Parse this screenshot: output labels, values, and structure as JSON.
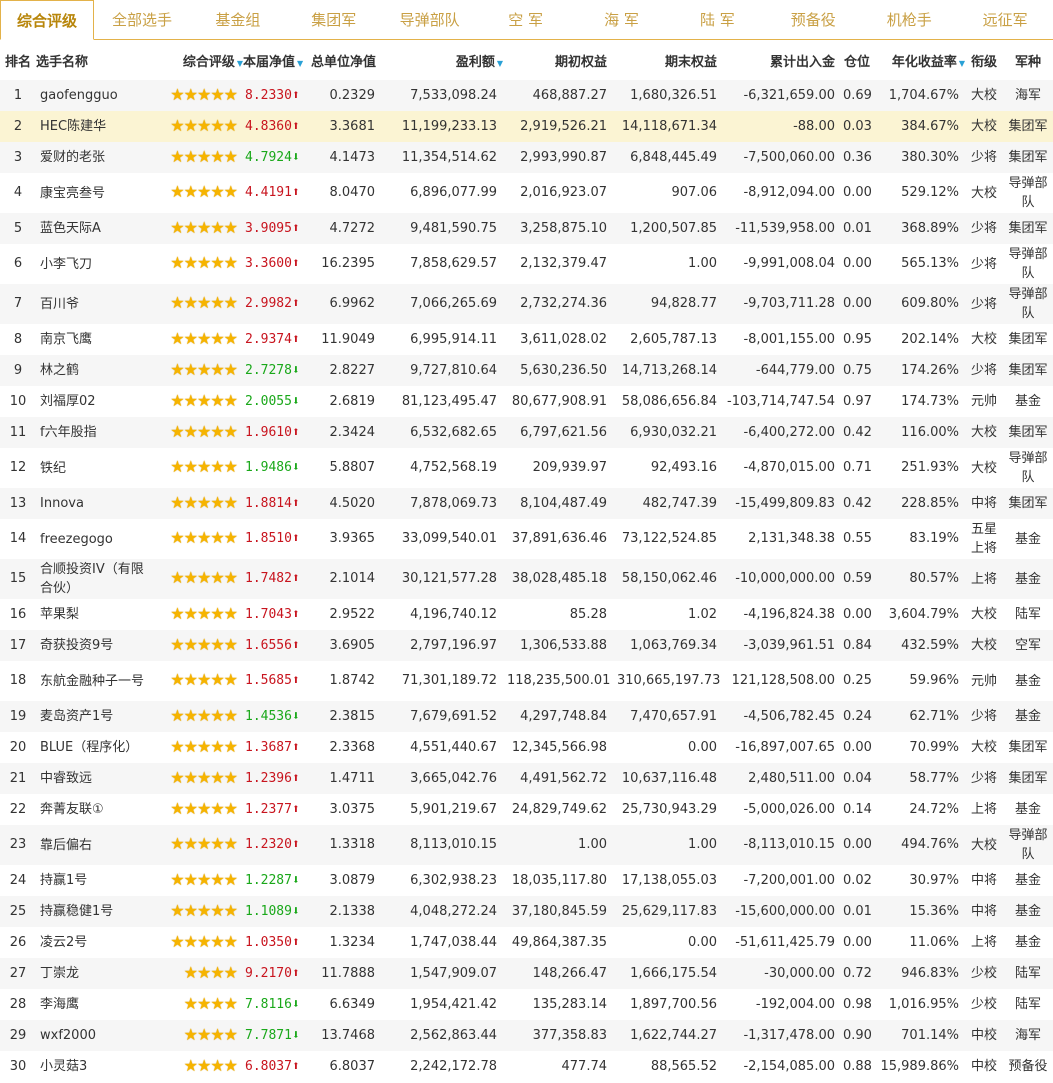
{
  "tabs": [
    "综合评级",
    "全部选手",
    "基金组",
    "集团军",
    "导弹部队",
    "空 军",
    "海 军",
    "陆 军",
    "预备役",
    "机枪手",
    "远征军"
  ],
  "active_tab": 0,
  "columns": {
    "rank": "排名",
    "name": "选手名称",
    "rating": "综合评级",
    "nav": "本届净值",
    "total_nav": "总单位净值",
    "profit": "盈利额",
    "start": "期初权益",
    "end": "期末权益",
    "flow": "累计出入金",
    "pos": "仓位",
    "annual": "年化收益率",
    "title": "衔级",
    "branch": "军种"
  },
  "icons": {
    "star": "star-icon",
    "sort": "sort-down-icon",
    "up": "arrow-up-icon",
    "down": "arrow-down-icon"
  },
  "colors": {
    "up": "#c8141e",
    "down": "#1aa81a",
    "star": "#f6b400",
    "accent": "#e3b24a"
  },
  "rows": [
    {
      "rank": "1",
      "name": "gaofengguo",
      "stars": 5,
      "nav": "8.2330",
      "dir": "up",
      "total": "0.2329",
      "profit": "7,533,098.24",
      "start": "468,887.27",
      "end": "1,680,326.51",
      "flow": "-6,321,659.00",
      "pos": "0.69",
      "annual": "1,704.67%",
      "title": "大校",
      "branch": "海军"
    },
    {
      "rank": "2",
      "name": "HEC陈建华",
      "stars": 5,
      "nav": "4.8360",
      "dir": "up",
      "total": "3.3681",
      "profit": "11,199,233.13",
      "start": "2,919,526.21",
      "end": "14,118,671.34",
      "flow": "-88.00",
      "pos": "0.03",
      "annual": "384.67%",
      "title": "大校",
      "branch": "集团军",
      "highlight": true
    },
    {
      "rank": "3",
      "name": "爱财的老张",
      "stars": 5,
      "nav": "4.7924",
      "dir": "down",
      "total": "4.1473",
      "profit": "11,354,514.62",
      "start": "2,993,990.87",
      "end": "6,848,445.49",
      "flow": "-7,500,060.00",
      "pos": "0.36",
      "annual": "380.30%",
      "title": "少将",
      "branch": "集团军"
    },
    {
      "rank": "4",
      "name": "康宝亮叁号",
      "stars": 5,
      "nav": "4.4191",
      "dir": "up",
      "total": "8.0470",
      "profit": "6,896,077.99",
      "start": "2,016,923.07",
      "end": "907.06",
      "flow": "-8,912,094.00",
      "pos": "0.00",
      "annual": "529.12%",
      "title": "大校",
      "branch": "导弹部队"
    },
    {
      "rank": "5",
      "name": "蓝色天际A",
      "stars": 5,
      "nav": "3.9095",
      "dir": "up",
      "total": "4.7272",
      "profit": "9,481,590.75",
      "start": "3,258,875.10",
      "end": "1,200,507.85",
      "flow": "-11,539,958.00",
      "pos": "0.01",
      "annual": "368.89%",
      "title": "少将",
      "branch": "集团军"
    },
    {
      "rank": "6",
      "name": "小李飞刀",
      "stars": 5,
      "nav": "3.3600",
      "dir": "up",
      "total": "16.2395",
      "profit": "7,858,629.57",
      "start": "2,132,379.47",
      "end": "1.00",
      "flow": "-9,991,008.04",
      "pos": "0.00",
      "annual": "565.13%",
      "title": "少将",
      "branch": "导弹部队"
    },
    {
      "rank": "7",
      "name": "百川爷",
      "stars": 5,
      "nav": "2.9982",
      "dir": "up",
      "total": "6.9962",
      "profit": "7,066,265.69",
      "start": "2,732,274.36",
      "end": "94,828.77",
      "flow": "-9,703,711.28",
      "pos": "0.00",
      "annual": "609.80%",
      "title": "少将",
      "branch": "导弹部队"
    },
    {
      "rank": "8",
      "name": "南京飞鹰",
      "stars": 5,
      "nav": "2.9374",
      "dir": "up",
      "total": "11.9049",
      "profit": "6,995,914.11",
      "start": "3,611,028.02",
      "end": "2,605,787.13",
      "flow": "-8,001,155.00",
      "pos": "0.95",
      "annual": "202.14%",
      "title": "大校",
      "branch": "集团军"
    },
    {
      "rank": "9",
      "name": "林之鹤",
      "stars": 5,
      "nav": "2.7278",
      "dir": "down",
      "total": "2.8227",
      "profit": "9,727,810.64",
      "start": "5,630,236.50",
      "end": "14,713,268.14",
      "flow": "-644,779.00",
      "pos": "0.75",
      "annual": "174.26%",
      "title": "少将",
      "branch": "集团军"
    },
    {
      "rank": "10",
      "name": "刘福厚02",
      "stars": 5,
      "nav": "2.0055",
      "dir": "down",
      "total": "2.6819",
      "profit": "81,123,495.47",
      "start": "80,677,908.91",
      "end": "58,086,656.84",
      "flow": "-103,714,747.54",
      "pos": "0.97",
      "annual": "174.73%",
      "title": "元帅",
      "branch": "基金"
    },
    {
      "rank": "11",
      "name": "f六年股指",
      "stars": 5,
      "nav": "1.9610",
      "dir": "up",
      "total": "2.3424",
      "profit": "6,532,682.65",
      "start": "6,797,621.56",
      "end": "6,930,032.21",
      "flow": "-6,400,272.00",
      "pos": "0.42",
      "annual": "116.00%",
      "title": "大校",
      "branch": "集团军"
    },
    {
      "rank": "12",
      "name": "铁纪",
      "stars": 5,
      "nav": "1.9486",
      "dir": "down",
      "total": "5.8807",
      "profit": "4,752,568.19",
      "start": "209,939.97",
      "end": "92,493.16",
      "flow": "-4,870,015.00",
      "pos": "0.71",
      "annual": "251.93%",
      "title": "大校",
      "branch": "导弹部队"
    },
    {
      "rank": "13",
      "name": "Innova",
      "stars": 5,
      "nav": "1.8814",
      "dir": "up",
      "total": "4.5020",
      "profit": "7,878,069.73",
      "start": "8,104,487.49",
      "end": "482,747.39",
      "flow": "-15,499,809.83",
      "pos": "0.42",
      "annual": "228.85%",
      "title": "中将",
      "branch": "集团军"
    },
    {
      "rank": "14",
      "name": "freezegogo",
      "stars": 5,
      "nav": "1.8510",
      "dir": "up",
      "total": "3.9365",
      "profit": "33,099,540.01",
      "start": "37,891,636.46",
      "end": "73,122,524.85",
      "flow": "2,131,348.38",
      "pos": "0.55",
      "annual": "83.19%",
      "title": "五星上将",
      "branch": "基金"
    },
    {
      "rank": "15",
      "name": "合顺投资IV（有限合伙）",
      "stars": 5,
      "nav": "1.7482",
      "dir": "up",
      "total": "2.1014",
      "profit": "30,121,577.28",
      "start": "38,028,485.18",
      "end": "58,150,062.46",
      "flow": "-10,000,000.00",
      "pos": "0.59",
      "annual": "80.57%",
      "title": "上将",
      "branch": "基金"
    },
    {
      "rank": "16",
      "name": "苹果梨",
      "stars": 5,
      "nav": "1.7043",
      "dir": "up",
      "total": "2.9522",
      "profit": "4,196,740.12",
      "start": "85.28",
      "end": "1.02",
      "flow": "-4,196,824.38",
      "pos": "0.00",
      "annual": "3,604.79%",
      "title": "大校",
      "branch": "陆军"
    },
    {
      "rank": "17",
      "name": "奇获投资9号",
      "stars": 5,
      "nav": "1.6556",
      "dir": "up",
      "total": "3.6905",
      "profit": "2,797,196.97",
      "start": "1,306,533.88",
      "end": "1,063,769.34",
      "flow": "-3,039,961.51",
      "pos": "0.84",
      "annual": "432.59%",
      "title": "大校",
      "branch": "空军"
    },
    {
      "rank": "18",
      "name": "东航金融种子一号",
      "stars": 5,
      "nav": "1.5685",
      "dir": "up",
      "total": "1.8742",
      "profit": "71,301,189.72",
      "start": "118,235,500.01",
      "end": "310,665,197.73",
      "flow": "121,128,508.00",
      "pos": "0.25",
      "annual": "59.96%",
      "title": "元帅",
      "branch": "基金"
    },
    {
      "rank": "19",
      "name": "麦岛资产1号",
      "stars": 5,
      "nav": "1.4536",
      "dir": "down",
      "total": "2.3815",
      "profit": "7,679,691.52",
      "start": "4,297,748.84",
      "end": "7,470,657.91",
      "flow": "-4,506,782.45",
      "pos": "0.24",
      "annual": "62.71%",
      "title": "少将",
      "branch": "基金"
    },
    {
      "rank": "20",
      "name": "BLUE（程序化）",
      "stars": 5,
      "nav": "1.3687",
      "dir": "up",
      "total": "2.3368",
      "profit": "4,551,440.67",
      "start": "12,345,566.98",
      "end": "0.00",
      "flow": "-16,897,007.65",
      "pos": "0.00",
      "annual": "70.99%",
      "title": "大校",
      "branch": "集团军"
    },
    {
      "rank": "21",
      "name": "中睿致远",
      "stars": 5,
      "nav": "1.2396",
      "dir": "up",
      "total": "1.4711",
      "profit": "3,665,042.76",
      "start": "4,491,562.72",
      "end": "10,637,116.48",
      "flow": "2,480,511.00",
      "pos": "0.04",
      "annual": "58.77%",
      "title": "少将",
      "branch": "集团军"
    },
    {
      "rank": "22",
      "name": "奔菁友联①",
      "stars": 5,
      "nav": "1.2377",
      "dir": "up",
      "total": "3.0375",
      "profit": "5,901,219.67",
      "start": "24,829,749.62",
      "end": "25,730,943.29",
      "flow": "-5,000,026.00",
      "pos": "0.14",
      "annual": "24.72%",
      "title": "上将",
      "branch": "基金"
    },
    {
      "rank": "23",
      "name": "靠后偏右",
      "stars": 5,
      "nav": "1.2320",
      "dir": "up",
      "total": "1.3318",
      "profit": "8,113,010.15",
      "start": "1.00",
      "end": "1.00",
      "flow": "-8,113,010.15",
      "pos": "0.00",
      "annual": "494.76%",
      "title": "大校",
      "branch": "导弹部队"
    },
    {
      "rank": "24",
      "name": "持赢1号",
      "stars": 5,
      "nav": "1.2287",
      "dir": "down",
      "total": "3.0879",
      "profit": "6,302,938.23",
      "start": "18,035,117.80",
      "end": "17,138,055.03",
      "flow": "-7,200,001.00",
      "pos": "0.02",
      "annual": "30.97%",
      "title": "中将",
      "branch": "基金"
    },
    {
      "rank": "25",
      "name": "持赢稳健1号",
      "stars": 5,
      "nav": "1.1089",
      "dir": "down",
      "total": "2.1338",
      "profit": "4,048,272.24",
      "start": "37,180,845.59",
      "end": "25,629,117.83",
      "flow": "-15,600,000.00",
      "pos": "0.01",
      "annual": "15.36%",
      "title": "中将",
      "branch": "基金"
    },
    {
      "rank": "26",
      "name": "凌云2号",
      "stars": 5,
      "nav": "1.0350",
      "dir": "up",
      "total": "1.3234",
      "profit": "1,747,038.44",
      "start": "49,864,387.35",
      "end": "0.00",
      "flow": "-51,611,425.79",
      "pos": "0.00",
      "annual": "11.06%",
      "title": "上将",
      "branch": "基金"
    },
    {
      "rank": "27",
      "name": "丁崇龙",
      "stars": 4,
      "nav": "9.2170",
      "dir": "up",
      "total": "11.7888",
      "profit": "1,547,909.07",
      "start": "148,266.47",
      "end": "1,666,175.54",
      "flow": "-30,000.00",
      "pos": "0.72",
      "annual": "946.83%",
      "title": "少校",
      "branch": "陆军"
    },
    {
      "rank": "28",
      "name": "李海鹰",
      "stars": 4,
      "nav": "7.8116",
      "dir": "down",
      "total": "6.6349",
      "profit": "1,954,421.42",
      "start": "135,283.14",
      "end": "1,897,700.56",
      "flow": "-192,004.00",
      "pos": "0.98",
      "annual": "1,016.95%",
      "title": "少校",
      "branch": "陆军"
    },
    {
      "rank": "29",
      "name": "wxf2000",
      "stars": 4,
      "nav": "7.7871",
      "dir": "down",
      "total": "13.7468",
      "profit": "2,562,863.44",
      "start": "377,358.83",
      "end": "1,622,744.27",
      "flow": "-1,317,478.00",
      "pos": "0.90",
      "annual": "701.14%",
      "title": "中校",
      "branch": "海军"
    },
    {
      "rank": "30",
      "name": "小灵菇3",
      "stars": 4,
      "nav": "6.8037",
      "dir": "up",
      "total": "6.8037",
      "profit": "2,242,172.78",
      "start": "477.74",
      "end": "88,565.52",
      "flow": "-2,154,085.00",
      "pos": "0.88",
      "annual": "15,989.86%",
      "title": "中校",
      "branch": "预备役"
    }
  ]
}
